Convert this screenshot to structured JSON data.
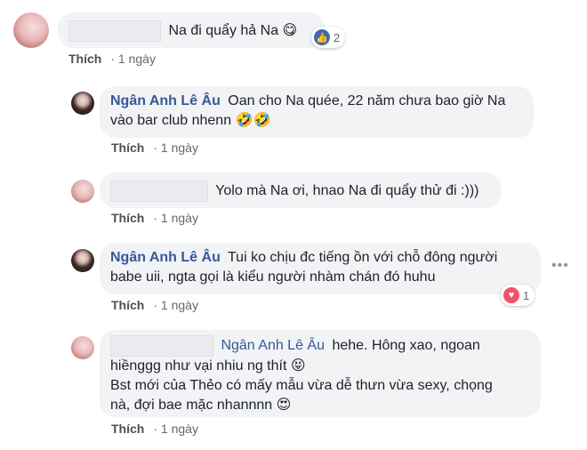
{
  "comments": [
    {
      "text": "Na đi quẩy hả Na",
      "emoji": "😋",
      "reactions": {
        "type": "like",
        "count": "2"
      },
      "like_label": "Thích",
      "time": "1 ngày"
    },
    {
      "author": "Ngân Anh Lê Âu",
      "text_line1": "Oan cho Na quée, 22 năm chưa bao giờ Na",
      "text_line2": "vào bar club nhenn",
      "emoji": "🤣🤣",
      "like_label": "Thích",
      "time": "1 ngày"
    },
    {
      "text": "Yolo mà Na ơi, hnao Na đi quẩy thử đi :)))",
      "like_label": "Thích",
      "time": "1 ngày"
    },
    {
      "author": "Ngân Anh Lê Âu",
      "text_line1": "Tui ko chịu đc tiếng ồn với chỗ đông người",
      "text_line2": "babe uii, ngta gọi là kiểu người nhàm chán đó huhu",
      "reactions": {
        "type": "love",
        "count": "1"
      },
      "more": "•••",
      "like_label": "Thích",
      "time": "1 ngày"
    },
    {
      "mention": "Ngân Anh Lê Âu",
      "text_line1": "hehe. Hông xao, ngoan",
      "text_line2": "hiềnggg như vại nhiu ng thít",
      "emoji2": "😝",
      "text_line3": "Bst mới của Thẻo có mấy mẫu vừa dễ thưn vừa sexy, chọng",
      "text_line4": "nà, đợi bae mặc nhannnn",
      "emoji4": "😍",
      "like_label": "Thích",
      "time": "1 ngày"
    }
  ]
}
